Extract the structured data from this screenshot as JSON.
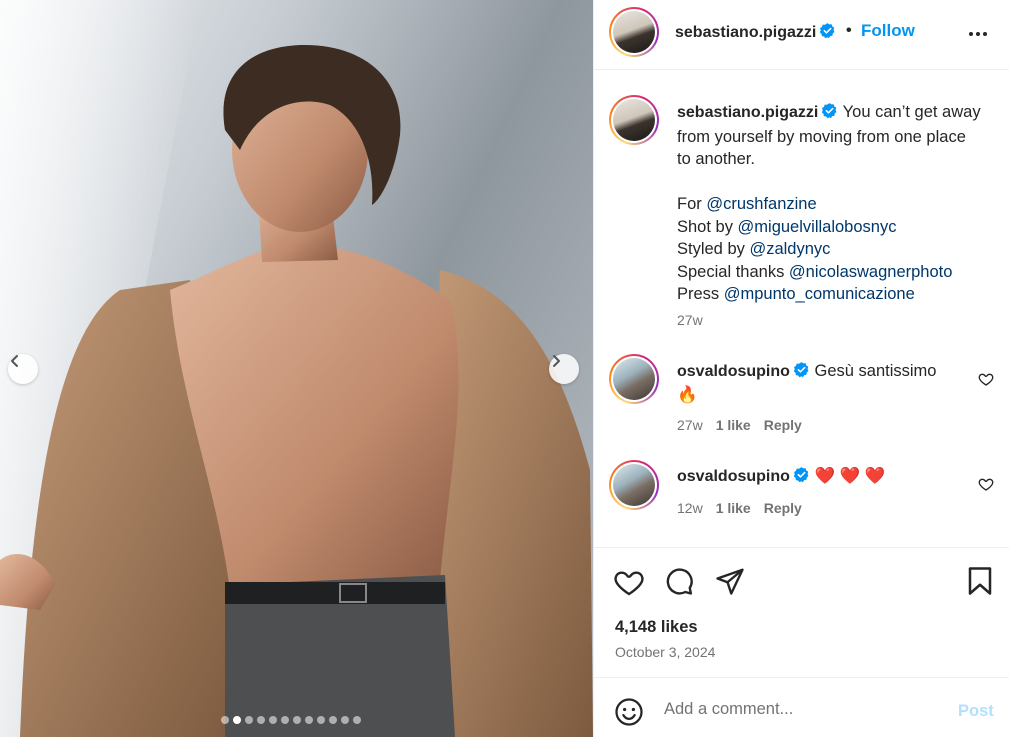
{
  "post": {
    "username": "sebastiano.pigazzi",
    "follow_label": "Follow",
    "separator": "•",
    "caption_lines": [
      {
        "text": "You can’t get away"
      },
      {
        "text": "from yourself by moving from one place"
      },
      {
        "text": "to another."
      }
    ],
    "credits": [
      {
        "prefix": "For ",
        "handle": "@crushfanzine"
      },
      {
        "prefix": "Shot by ",
        "handle": "@miguelvillalobosnyc"
      },
      {
        "prefix": "Styled by ",
        "handle": "@zaldynyc"
      },
      {
        "prefix": "Special thanks ",
        "handle": "@nicolaswagnerphoto"
      },
      {
        "prefix": "Press ",
        "handle": "@mpunto_comunicazione"
      }
    ],
    "caption_time": "27w",
    "likes": "4,148 likes",
    "date": "October 3, 2024",
    "carousel": {
      "total_slides": 12,
      "active_index": 1
    }
  },
  "comments": [
    {
      "username": "osvaldosupino",
      "text": "Gesù santissimo",
      "emoji": "🔥",
      "time": "27w",
      "likes": "1 like",
      "reply": "Reply"
    },
    {
      "username": "osvaldosupino",
      "text": "❤️ ❤️ ❤️",
      "time": "12w",
      "likes": "1 like",
      "reply": "Reply"
    }
  ],
  "add_comment": {
    "placeholder": "Add a comment...",
    "post_label": "Post"
  },
  "colors": {
    "link": "#00376b",
    "follow": "#0095f6",
    "verified": "#0095f6",
    "muted": "#737373"
  },
  "icons": [
    "heart-icon",
    "comment-icon",
    "share-icon",
    "bookmark-icon",
    "more-icon",
    "emoji-icon",
    "verified-icon",
    "chevron-left-icon",
    "chevron-right-icon"
  ]
}
